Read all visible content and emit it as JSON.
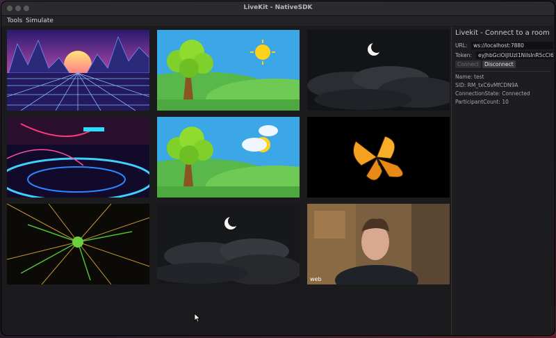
{
  "window": {
    "title": "LiveKit - NativeSDK"
  },
  "menu": {
    "tools": "Tools",
    "simulate": "Simulate"
  },
  "tiles": [
    {
      "name": "synthwave-video"
    },
    {
      "name": "cartoon-tree-video"
    },
    {
      "name": "night-moon-video"
    },
    {
      "name": "neon-lights-video"
    },
    {
      "name": "cartoon-tree-video-2"
    },
    {
      "name": "butterfly-video"
    },
    {
      "name": "tunnel-video"
    },
    {
      "name": "night-moon-video-2"
    },
    {
      "name": "webcam-video",
      "label": "web"
    }
  ],
  "panel": {
    "title": "Livekit - Connect to a room",
    "url_label": "URL:",
    "url_value": "ws://localhost:7880",
    "token_label": "Token:",
    "token_value": "eyJhbGciOiJIUzI1NiIsInR5cCI6",
    "connect": "Connect",
    "disconnect": "Disconnect",
    "name": "Name: test",
    "sid": "SID: RM_txC6vMfCDN9A",
    "state": "ConnectionState: Connected",
    "count": "ParticipantCount: 10"
  }
}
